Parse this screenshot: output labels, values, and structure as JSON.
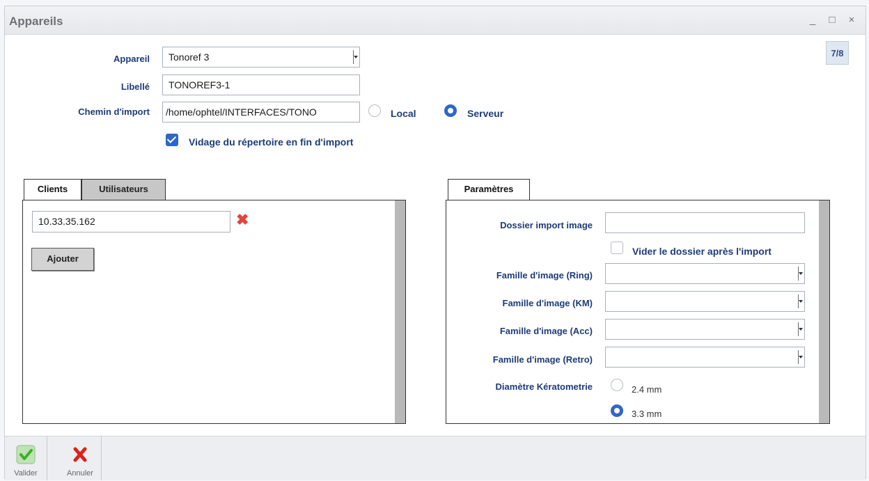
{
  "window": {
    "title": "Appareils",
    "minimize": "_",
    "maximize": "□",
    "close": "×",
    "page_indicator": "7/8"
  },
  "form": {
    "appareil": {
      "label": "Appareil",
      "value": "Tonoref 3"
    },
    "libelle": {
      "label": "Libellé",
      "value": "TONOREF3-1"
    },
    "chemin": {
      "label": "Chemin d'import",
      "value": "/home/ophtel/INTERFACES/TONO",
      "option_local": "Local",
      "option_serveur": "Serveur",
      "selected": "Serveur"
    },
    "vidage": {
      "label": "Vidage du répertoire en fin d'import",
      "checked": true
    }
  },
  "left_panel": {
    "tabs": [
      {
        "label": "Clients",
        "active": true
      },
      {
        "label": "Utilisateurs",
        "active": false
      }
    ],
    "clients": [
      {
        "ip": "10.33.35.162"
      }
    ],
    "add_button": "Ajouter"
  },
  "right_panel": {
    "tab": "Paramètres",
    "dossier_import_image": {
      "label": "Dossier import image",
      "value": ""
    },
    "vider_dossier": {
      "label": "Vider le dossier après l'import",
      "checked": false
    },
    "familles": [
      {
        "label": "Famille d'image (Ring)",
        "value": ""
      },
      {
        "label": "Famille d'image (KM)",
        "value": ""
      },
      {
        "label": "Famille d'image (Acc)",
        "value": ""
      },
      {
        "label": "Famille d'image (Retro)",
        "value": ""
      }
    ],
    "diametre": {
      "label": "Diamètre Kératometrie",
      "options": [
        "2.4 mm",
        "3.3 mm"
      ],
      "selected": "3.3 mm"
    }
  },
  "footer": {
    "validate": "Valider",
    "cancel": "Annuler"
  },
  "colors": {
    "label_blue": "#1d3b78",
    "accent_blue": "#2e67c9",
    "remove_red": "#e0453f",
    "validate_green": "#3fae2a"
  }
}
